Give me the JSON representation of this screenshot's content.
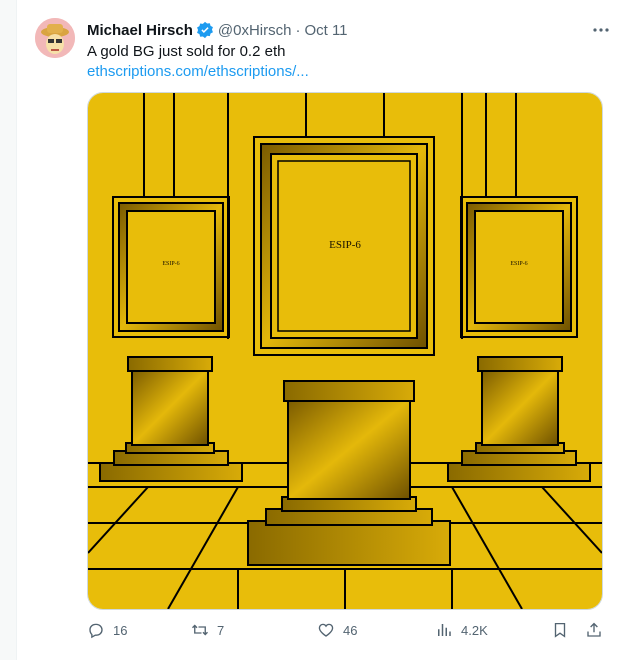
{
  "tweet": {
    "author_name": "Michael Hirsch",
    "handle": "@0xHirsch",
    "separator": "·",
    "date": "Oct 11",
    "text": "A gold BG just sold for 0.2 eth",
    "link": "ethscriptions.com/ethscriptions/...",
    "media": {
      "center_frame_label": "ESIP-6",
      "left_frame_label": "ESIP-6",
      "right_frame_label": "ESIP-6",
      "background_color": "#e8bd0a"
    },
    "actions": {
      "replies": "16",
      "reposts": "7",
      "likes": "46",
      "views": "4.2K"
    },
    "icons": [
      "verified-badge-icon",
      "more-icon",
      "reply-icon",
      "repost-icon",
      "like-icon",
      "views-icon",
      "bookmark-icon",
      "share-icon"
    ],
    "colors": {
      "link": "#1d9bf0",
      "muted": "#536471",
      "verified": "#1d9bf0"
    }
  }
}
